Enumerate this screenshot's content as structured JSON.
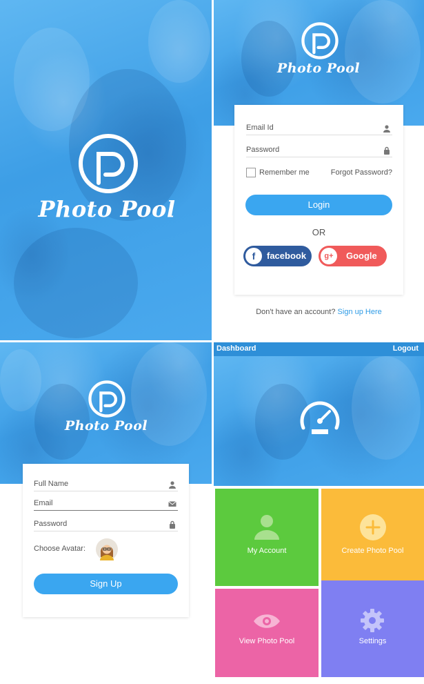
{
  "splash": {
    "app_name": "Photo Pool"
  },
  "login": {
    "app_name": "Photo Pool",
    "email_label": "Email Id",
    "password_label": "Password",
    "remember_label": "Remember me",
    "forgot_label": "Forgot Password?",
    "login_button": "Login",
    "or_text": "OR",
    "facebook_label": "facebook",
    "facebook_badge": "f",
    "google_label": "Google",
    "google_badge": "g+",
    "no_account_text": "Don't have an account?",
    "signup_link": "Sign up Here",
    "icons": [
      "person-icon",
      "lock-icon"
    ]
  },
  "signup": {
    "app_name": "Photo Pool",
    "fullname_label": "Full Name",
    "email_label": "Email",
    "password_label": "Password",
    "avatar_label": "Choose Avatar:",
    "signup_button": "Sign Up",
    "icons": [
      "person-icon",
      "envelope-icon",
      "lock-icon"
    ]
  },
  "dashboard": {
    "title": "Dashboard",
    "logout": "Logout",
    "tiles": [
      {
        "label": "My Account",
        "icon": "user-icon",
        "color": "#5cca3e"
      },
      {
        "label": "Create Photo Pool",
        "icon": "plus-circle-icon",
        "color": "#fbbb3a"
      },
      {
        "label": "View Photo Pool",
        "icon": "eye-icon",
        "color": "#ec64a6"
      },
      {
        "label": "Settings",
        "icon": "gear-icon",
        "color": "#7f7ff2"
      }
    ]
  },
  "colors": {
    "brand_blue": "#3aa6f0",
    "facebook": "#2f5b9e",
    "google": "#f05a5a",
    "link": "#2e9be6"
  }
}
